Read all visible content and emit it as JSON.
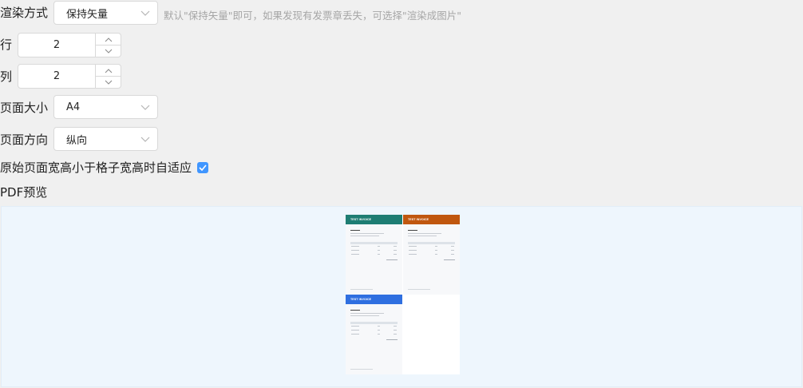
{
  "render_mode": {
    "label": "渲染方式",
    "value": "保持矢量",
    "hint": "默认\"保持矢量\"即可，如果发现有发票章丢失，可选择\"渲染成图片\""
  },
  "rows": {
    "label": "行",
    "value": "2"
  },
  "cols": {
    "label": "列",
    "value": "2"
  },
  "page_size": {
    "label": "页面大小",
    "value": "A4"
  },
  "orientation": {
    "label": "页面方向",
    "value": "纵向"
  },
  "autofit": {
    "label": "原始页面宽高小于格子宽高时自适应",
    "checked": true
  },
  "preview": {
    "label": "PDF预览",
    "invoices": [
      {
        "title": "TEST INVOICE",
        "color": "#1e7d73"
      },
      {
        "title": "TEST INVOICE",
        "color": "#c0570f"
      },
      {
        "title": "TEST INVOICE",
        "color": "#2f6fe0"
      }
    ]
  },
  "colors": {
    "accent": "#4096ff",
    "background": "#f0f0f0",
    "preview_bg": "#eef6fd"
  }
}
